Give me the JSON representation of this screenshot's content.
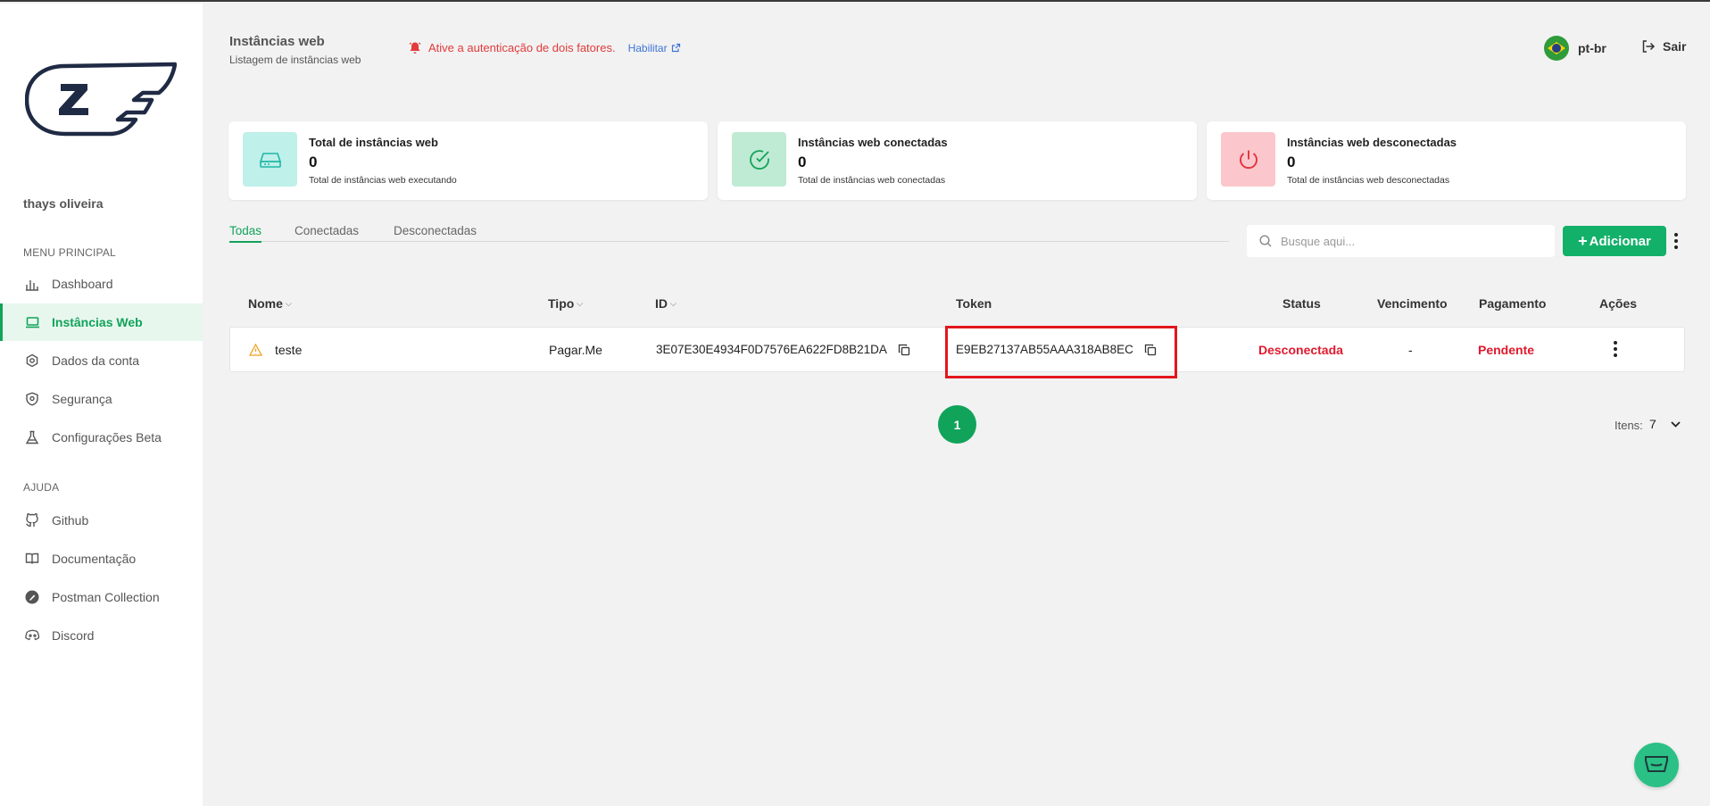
{
  "sidebar": {
    "username": "thays oliveira",
    "menu_label": "MENU PRINCIPAL",
    "menu_items": [
      {
        "label": "Dashboard",
        "icon": "bar-chart-icon"
      },
      {
        "label": "Instâncias Web",
        "icon": "laptop-icon",
        "active": true
      },
      {
        "label": "Dados da conta",
        "icon": "gear-icon"
      },
      {
        "label": "Segurança",
        "icon": "shield-icon"
      },
      {
        "label": "Configurações Beta",
        "icon": "flask-icon"
      }
    ],
    "help_label": "AJUDA",
    "help_items": [
      {
        "label": "Github",
        "icon": "github-icon"
      },
      {
        "label": "Documentação",
        "icon": "book-icon"
      },
      {
        "label": "Postman Collection",
        "icon": "postman-icon"
      },
      {
        "label": "Discord",
        "icon": "discord-icon"
      }
    ]
  },
  "header": {
    "title": "Instâncias web",
    "subtitle": "Listagem de instâncias web",
    "alert_text": "Ative a autenticação de dois fatores.",
    "alert_link": "Habilitar",
    "language": "pt-br",
    "logout": "Sair"
  },
  "cards": [
    {
      "title": "Total de instâncias web",
      "value": "0",
      "subtitle": "Total de instâncias web executando",
      "icon": "drive-icon",
      "color": "#bff0ea"
    },
    {
      "title": "Instâncias web conectadas",
      "value": "0",
      "subtitle": "Total de instâncias web conectadas",
      "icon": "check-circle-icon",
      "color": "#bfead3"
    },
    {
      "title": "Instâncias web desconectadas",
      "value": "0",
      "subtitle": "Total de instâncias web desconectadas",
      "icon": "power-icon",
      "color": "#fbc7cc"
    }
  ],
  "tabs": [
    {
      "label": "Todas",
      "active": true
    },
    {
      "label": "Conectadas"
    },
    {
      "label": "Desconectadas"
    }
  ],
  "search": {
    "placeholder": "Busque aqui..."
  },
  "add_button": "Adicionar",
  "table": {
    "headers": {
      "name": "Nome",
      "type": "Tipo",
      "id": "ID",
      "token": "Token",
      "status": "Status",
      "due": "Vencimento",
      "payment": "Pagamento",
      "actions": "Ações"
    },
    "rows": [
      {
        "name": "teste",
        "type": "Pagar.Me",
        "id": "3E07E30E4934F0D7576EA622FD8B21DA",
        "token": "E9EB27137AB55AAA318AB8EC",
        "status": "Desconectada",
        "due": "-",
        "payment": "Pendente"
      }
    ]
  },
  "pagination": {
    "current": "1",
    "items_label": "Itens:",
    "items_value": "7"
  },
  "colors": {
    "accent": "#11a35a",
    "danger": "#e0192e",
    "link": "#3d74d6"
  }
}
